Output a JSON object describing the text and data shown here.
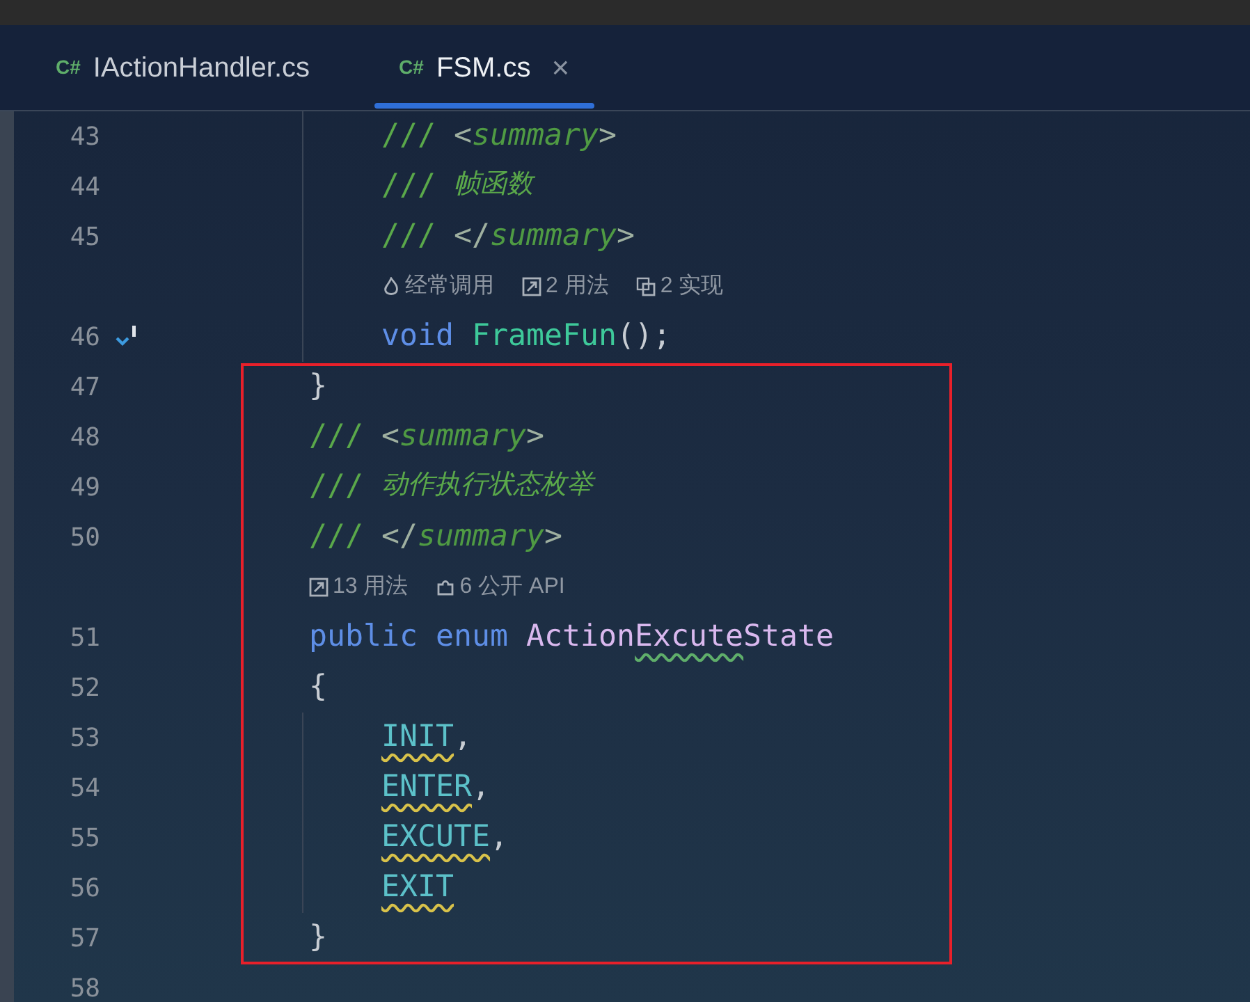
{
  "tabs": [
    {
      "label": "IActionHandler.cs",
      "icon": "C#",
      "selected": false
    },
    {
      "label": "FSM.cs",
      "icon": "C#",
      "selected": true,
      "close": "×"
    }
  ],
  "lines": [
    {
      "kind": "block",
      "children": [
        {
          "kind": "code",
          "number": "43",
          "tokens": [
            {
              "text": "/// ",
              "kind": "comment"
            },
            {
              "text": "<",
              "kind": "doc_punct"
            },
            {
              "text": "summary",
              "kind": "doc_tag"
            },
            {
              "text": ">",
              "kind": "doc_punct"
            }
          ]
        },
        {
          "kind": "code",
          "number": "44",
          "tokens": [
            {
              "text": "/// ",
              "kind": "comment"
            },
            {
              "text": "帧函数",
              "kind": "comment_text"
            }
          ]
        },
        {
          "kind": "code",
          "number": "45",
          "tokens": [
            {
              "text": "/// ",
              "kind": "comment"
            },
            {
              "text": "</",
              "kind": "doc_punct"
            },
            {
              "text": "summary",
              "kind": "doc_tag"
            },
            {
              "text": ">",
              "kind": "doc_punct"
            }
          ]
        },
        {
          "kind": "hint",
          "items": [
            {
              "kind": "frequent",
              "text": "经常调用"
            },
            {
              "kind": "usages",
              "text": "2 用法"
            },
            {
              "kind": "implementations",
              "text": "2 实现"
            }
          ]
        },
        {
          "kind": "code",
          "number": "46",
          "implemented": true,
          "tokens": [
            {
              "text": "void ",
              "kind": "keyword"
            },
            {
              "text": "FrameFun",
              "kind": "method"
            },
            {
              "text": "();",
              "kind": "punct"
            }
          ]
        }
      ]
    },
    {
      "kind": "highlight_box",
      "children": [
        {
          "kind": "code",
          "number": "47",
          "tokens": [
            {
              "text": "}",
              "kind": "punct"
            }
          ]
        },
        {
          "kind": "code",
          "number": "48",
          "tokens": [
            {
              "text": "/// ",
              "kind": "comment"
            },
            {
              "text": "<",
              "kind": "doc_punct"
            },
            {
              "text": "summary",
              "kind": "doc_tag"
            },
            {
              "text": ">",
              "kind": "doc_punct"
            }
          ]
        },
        {
          "kind": "code",
          "number": "49",
          "tokens": [
            {
              "text": "/// ",
              "kind": "comment"
            },
            {
              "text": "动作执行状态枚举",
              "kind": "comment_text"
            }
          ]
        },
        {
          "kind": "code",
          "number": "50",
          "tokens": [
            {
              "text": "/// ",
              "kind": "comment"
            },
            {
              "text": "</",
              "kind": "doc_punct"
            },
            {
              "text": "summary",
              "kind": "doc_tag"
            },
            {
              "text": ">",
              "kind": "doc_punct"
            }
          ]
        },
        {
          "kind": "hint",
          "items": [
            {
              "kind": "usages",
              "text": "13 用法"
            },
            {
              "kind": "public_api",
              "text": "6 公开 API"
            }
          ]
        },
        {
          "kind": "code",
          "number": "51",
          "tokens": [
            {
              "text": "public enum ",
              "kind": "keyword"
            },
            {
              "text": "Action",
              "kind": "type"
            },
            {
              "text": "Excute",
              "kind": "type",
              "typo": true
            },
            {
              "text": "State",
              "kind": "type"
            }
          ]
        },
        {
          "kind": "code",
          "number": "52",
          "tokens": [
            {
              "text": "{",
              "kind": "punct"
            }
          ]
        },
        {
          "kind": "block",
          "children": [
            {
              "kind": "code",
              "number": "53",
              "tokens": [
                {
                  "text": "INIT",
                  "kind": "enum_member",
                  "warning": true
                },
                {
                  "text": ",",
                  "kind": "punct"
                }
              ]
            },
            {
              "kind": "code",
              "number": "54",
              "tokens": [
                {
                  "text": "ENTER",
                  "kind": "enum_member",
                  "warning": true
                },
                {
                  "text": ",",
                  "kind": "punct"
                }
              ]
            },
            {
              "kind": "code",
              "number": "55",
              "tokens": [
                {
                  "text": "EXCUTE",
                  "kind": "enum_member",
                  "warning": true
                },
                {
                  "text": ",",
                  "kind": "punct"
                }
              ]
            },
            {
              "kind": "code",
              "number": "56",
              "tokens": [
                {
                  "text": "EXIT",
                  "kind": "enum_member",
                  "warning": true
                }
              ]
            }
          ]
        },
        {
          "kind": "code",
          "number": "57",
          "tokens": [
            {
              "text": "}",
              "kind": "punct"
            }
          ]
        }
      ]
    },
    {
      "kind": "code",
      "number": "58"
    }
  ]
}
